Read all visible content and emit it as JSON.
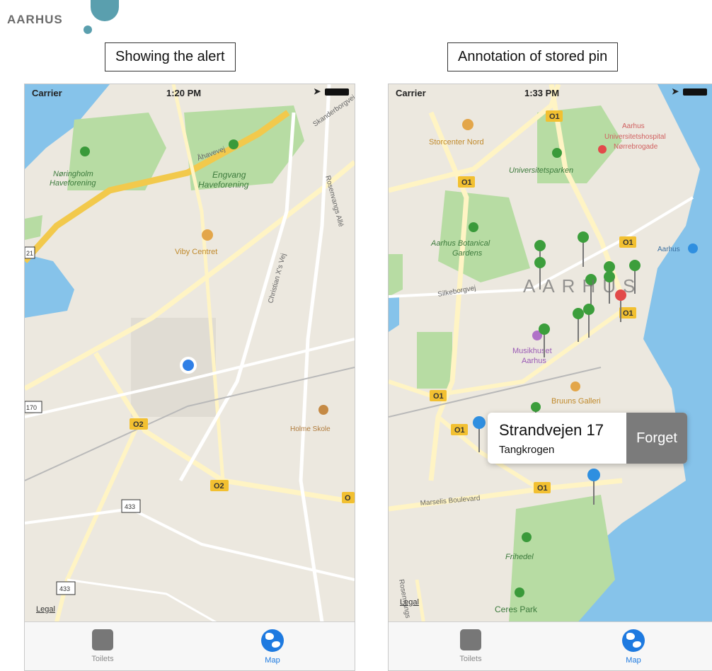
{
  "logo": {
    "text": "AARHUS"
  },
  "left_panel": {
    "caption": "Showing the alert",
    "status": {
      "carrier": "Carrier",
      "time": "1:20 PM"
    },
    "map_labels": {
      "park1": "Nøringholm\nHaveforening",
      "park2": "Engvang\nHaveforening",
      "centre": "Viby Centret",
      "school": "Holme Skole",
      "street1": "Åhavevej",
      "street2": "Skanderborgvej",
      "street3": "Rosenvangs Allé",
      "street4": "Christian X's Vej"
    },
    "route_badges": [
      "O2",
      "O2",
      "O"
    ],
    "shields": [
      "21",
      "170",
      "433",
      "433"
    ],
    "legal": "Legal",
    "tabs": [
      {
        "label": "Toilets",
        "icon": "database-icon",
        "active": false
      },
      {
        "label": "Map",
        "icon": "globe-icon",
        "active": true
      }
    ]
  },
  "right_panel": {
    "caption": "Annotation of stored pin",
    "status": {
      "carrier": "Carrier",
      "time": "1:33 PM"
    },
    "map_labels": {
      "mall": "Storcenter Nord",
      "hospital": "Aarhus\nUniversitetshospital\nNørrebrogade",
      "uni": "Universitetsparken",
      "botanic": "Aarhus Botanical\nGardens",
      "street": "Silkeborgvej",
      "city": "AARHUS",
      "musik": "Musikhuset\nAarhus",
      "bruuns": "Bruuns Galleri",
      "boulevard": "Marselis Boulevard",
      "frihed": "Frihedel",
      "ceres": "Ceres Park",
      "harbor": "Aarhus",
      "rosenv": "Rosenvangs"
    },
    "route_badges": [
      "O1",
      "O1",
      "O1",
      "O1",
      "O1",
      "O1",
      "O1"
    ],
    "callout": {
      "title": "Strandvejen 17",
      "subtitle": "Tangkrogen",
      "action": "Forget"
    },
    "legal": "Legal",
    "tabs": [
      {
        "label": "Toilets",
        "icon": "database-icon",
        "active": false
      },
      {
        "label": "Map",
        "icon": "globe-icon",
        "active": true
      }
    ]
  },
  "colors": {
    "map_bg": "#ece8df",
    "park": "#b7dca3",
    "water": "#86c3ea",
    "road_major": "#f6d67a",
    "road_highway": "#f2c94c",
    "pin_green": "#3c9e3c",
    "pin_red": "#e24a4a",
    "pin_blue": "#2f8fe0",
    "accent": "#1e7ae0"
  }
}
